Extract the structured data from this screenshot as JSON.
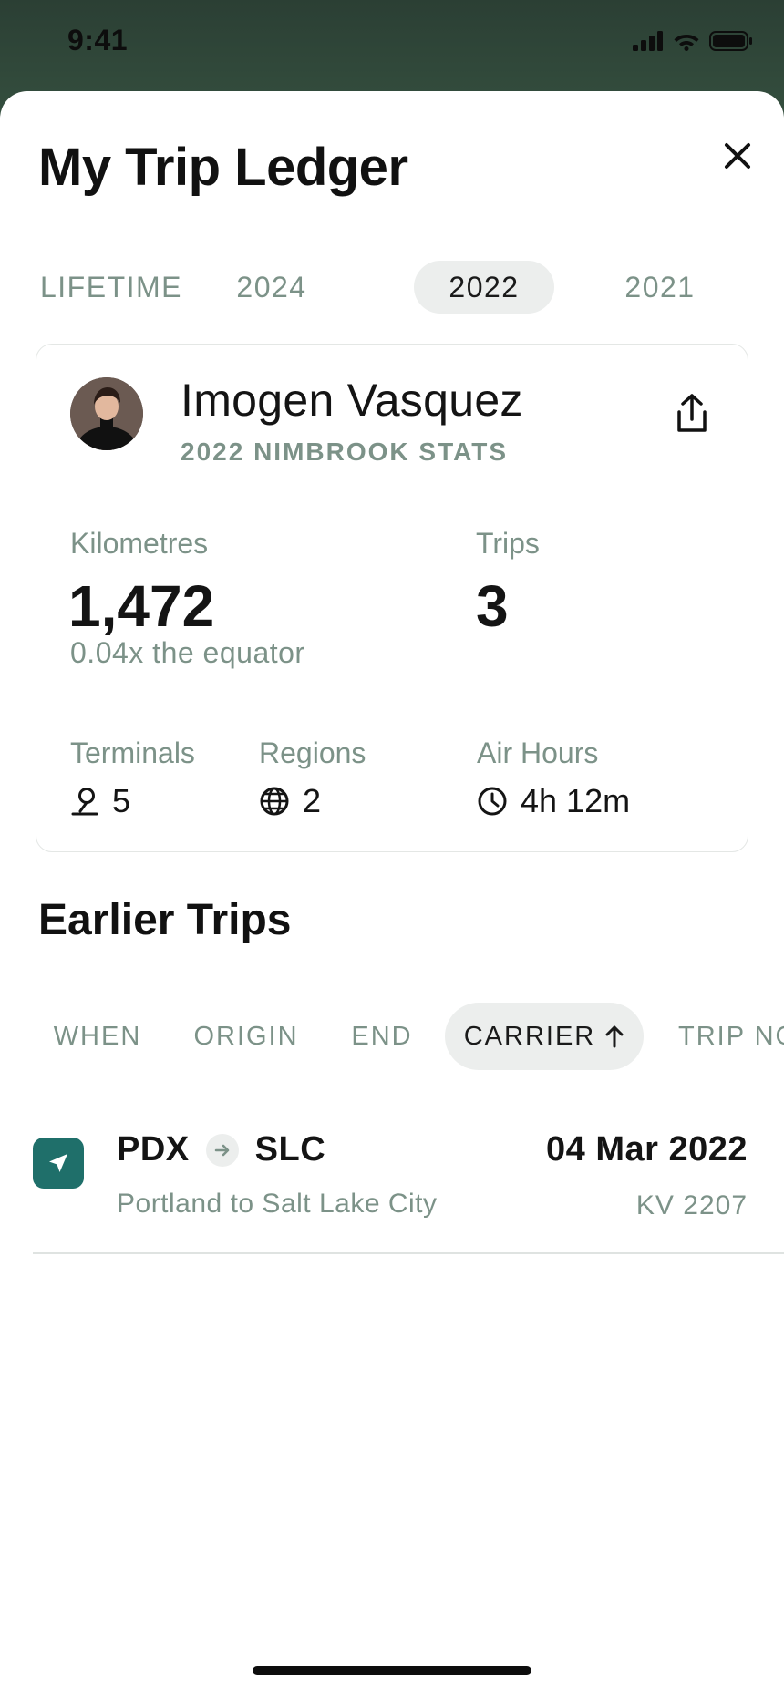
{
  "status_bar": {
    "time": "9:41"
  },
  "header": {
    "title": "My Trip Ledger"
  },
  "year_tabs": [
    {
      "label": "LIFETIME",
      "active": false
    },
    {
      "label": "2024",
      "active": false
    },
    {
      "label": "2022",
      "active": true
    },
    {
      "label": "2021",
      "active": false
    }
  ],
  "stats_card": {
    "user_name": "Imogen Vasquez",
    "subtitle": "2022 NIMBROOK STATS",
    "kilometres": {
      "label": "Kilometres",
      "value": "1,472",
      "note": "0.04x the equator"
    },
    "trips": {
      "label": "Trips",
      "value": "3"
    },
    "terminals": {
      "label": "Terminals",
      "value": "5",
      "icon": "map-pin-icon"
    },
    "regions": {
      "label": "Regions",
      "value": "2",
      "icon": "globe-icon"
    },
    "air_hours": {
      "label": "Air Hours",
      "value": "4h 12m",
      "icon": "clock-icon"
    }
  },
  "earlier_trips": {
    "title": "Earlier Trips",
    "sort_options": [
      {
        "label": "WHEN",
        "active": false
      },
      {
        "label": "ORIGIN",
        "active": false
      },
      {
        "label": "END",
        "active": false
      },
      {
        "label": "CARRIER",
        "active": true,
        "direction": "ascending"
      },
      {
        "label": "TRIP NO",
        "active": false
      }
    ],
    "trips": [
      {
        "origin": "PDX",
        "destination": "SLC",
        "cities": "Portland to Salt Lake City",
        "date": "04 Mar 2022",
        "trip_number": "KV 2207"
      }
    ]
  },
  "colors": {
    "accent_muted": "#7c9288",
    "chip_background": "#eceeed",
    "trip_icon": "#1f6f6a",
    "backdrop": "#2f4a3c"
  }
}
